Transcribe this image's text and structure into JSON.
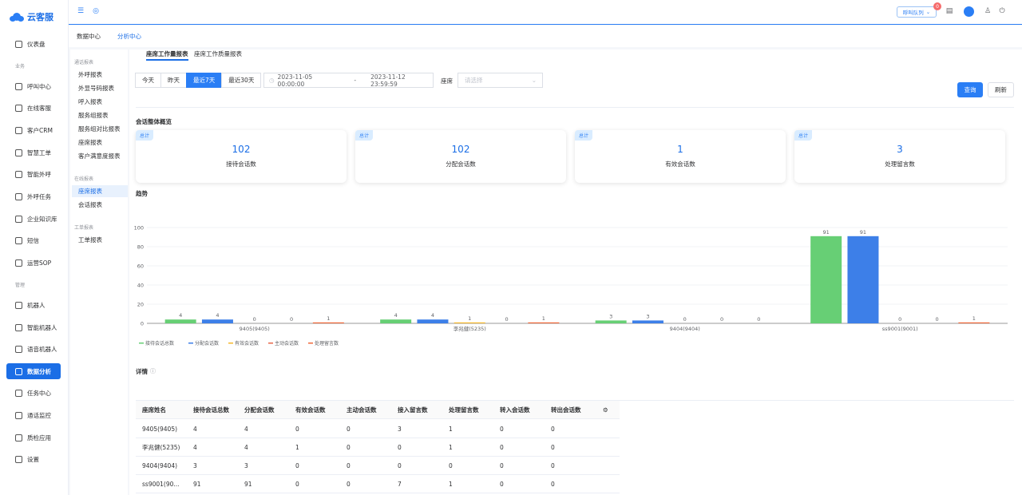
{
  "app": {
    "name": "云客服"
  },
  "sidebar": {
    "items": [
      {
        "label": "仪表盘",
        "icon": "home-icon"
      },
      {
        "group": "业务"
      },
      {
        "label": "呼叫中心",
        "icon": "phone-icon"
      },
      {
        "label": "在线客服",
        "icon": "headset-icon"
      },
      {
        "label": "客户CRM",
        "icon": "user-icon"
      },
      {
        "label": "智慧工单",
        "icon": "ticket-icon"
      },
      {
        "label": "智能外呼",
        "icon": "chat-icon"
      },
      {
        "label": "外呼任务",
        "icon": "call-task-icon"
      },
      {
        "label": "企业知识库",
        "icon": "book-icon"
      },
      {
        "label": "短信",
        "icon": "sms-icon"
      },
      {
        "label": "运营SOP",
        "icon": "flow-icon"
      },
      {
        "group": "管理"
      },
      {
        "label": "机器人",
        "icon": "robot-icon"
      },
      {
        "label": "智能机器人",
        "icon": "smart-robot-icon"
      },
      {
        "label": "语音机器人",
        "icon": "voice-robot-icon"
      },
      {
        "label": "数据分析",
        "icon": "chart-icon",
        "active": true
      },
      {
        "label": "任务中心",
        "icon": "task-icon"
      },
      {
        "label": "通话监控",
        "icon": "monitor-icon"
      },
      {
        "label": "质检应用",
        "icon": "quality-icon"
      },
      {
        "label": "设置",
        "icon": "settings-icon"
      }
    ]
  },
  "header": {
    "queue_label": "呼叫队列",
    "badge": "0"
  },
  "top_tabs": [
    "数据中心",
    "分析中心"
  ],
  "subnav": {
    "groups": [
      {
        "title": "通话报表",
        "items": [
          "外呼报表",
          "外显号码报表",
          "呼入报表",
          "服务组报表",
          "服务组对比报表",
          "座席报表",
          "客户满意度报表"
        ]
      },
      {
        "title": "在线报表",
        "items": [
          "座席报表",
          "会话报表"
        ]
      },
      {
        "title": "工单报表",
        "items": [
          "工单报表"
        ]
      }
    ],
    "active": "在线报表-座席报表"
  },
  "main": {
    "tabs": [
      "座席工作量报表",
      "座席工作质量报表"
    ],
    "quick_ranges": [
      "今天",
      "昨天",
      "最近7天",
      "最近30天"
    ],
    "active_range": "最近7天",
    "date_start": "2023-11-05 00:00:00",
    "date_sep": "-",
    "date_end": "2023-11-12 23:59:59",
    "seat_label": "座席",
    "seat_placeholder": "请选择",
    "query": "查询",
    "refresh": "刷新",
    "overview_title": "会话整体概览",
    "cards": [
      {
        "tag": "总计",
        "value": "102",
        "label": "接待会话数"
      },
      {
        "tag": "总计",
        "value": "102",
        "label": "分配会话数"
      },
      {
        "tag": "总计",
        "value": "1",
        "label": "有效会话数"
      },
      {
        "tag": "总计",
        "value": "3",
        "label": "处理留言数"
      }
    ],
    "trend_title": "趋势",
    "detail_title": "详情"
  },
  "chart_data": {
    "type": "bar",
    "categories": [
      "9405(9405)",
      "李兆健(5235)",
      "9404(9404)",
      "ss9001(9001)"
    ],
    "series": [
      {
        "name": "接待会话总数",
        "color": "#67cf75",
        "values": [
          4,
          4,
          3,
          91
        ]
      },
      {
        "name": "分配会话数",
        "color": "#3d7fe8",
        "values": [
          4,
          4,
          3,
          91
        ]
      },
      {
        "name": "有效会话数",
        "color": "#f5b82e",
        "values": [
          0,
          1,
          0,
          0
        ]
      },
      {
        "name": "主动会话数",
        "color": "#e8684a",
        "values": [
          0,
          0,
          0,
          0
        ]
      },
      {
        "name": "处理留言数",
        "color": "#f06a3b",
        "values": [
          1,
          1,
          0,
          1
        ]
      }
    ],
    "ylim": [
      0,
      100
    ],
    "yticks": [
      0,
      20,
      40,
      60,
      80,
      100
    ],
    "grid": true,
    "legend": "bottom-left"
  },
  "table": {
    "columns": [
      "座席姓名",
      "接待会话总数",
      "分配会话数",
      "有效会话数",
      "主动会话数",
      "接入留言数",
      "处理留言数",
      "转入会话数",
      "转出会话数"
    ],
    "rows": [
      [
        "9405(9405)",
        "4",
        "4",
        "0",
        "0",
        "3",
        "1",
        "0",
        "0"
      ],
      [
        "李兆健(5235)",
        "4",
        "4",
        "1",
        "0",
        "0",
        "1",
        "0",
        "0"
      ],
      [
        "9404(9404)",
        "3",
        "3",
        "0",
        "0",
        "0",
        "0",
        "0",
        "0"
      ],
      [
        "ss9001(90...",
        "91",
        "91",
        "0",
        "0",
        "7",
        "1",
        "0",
        "0"
      ]
    ]
  }
}
